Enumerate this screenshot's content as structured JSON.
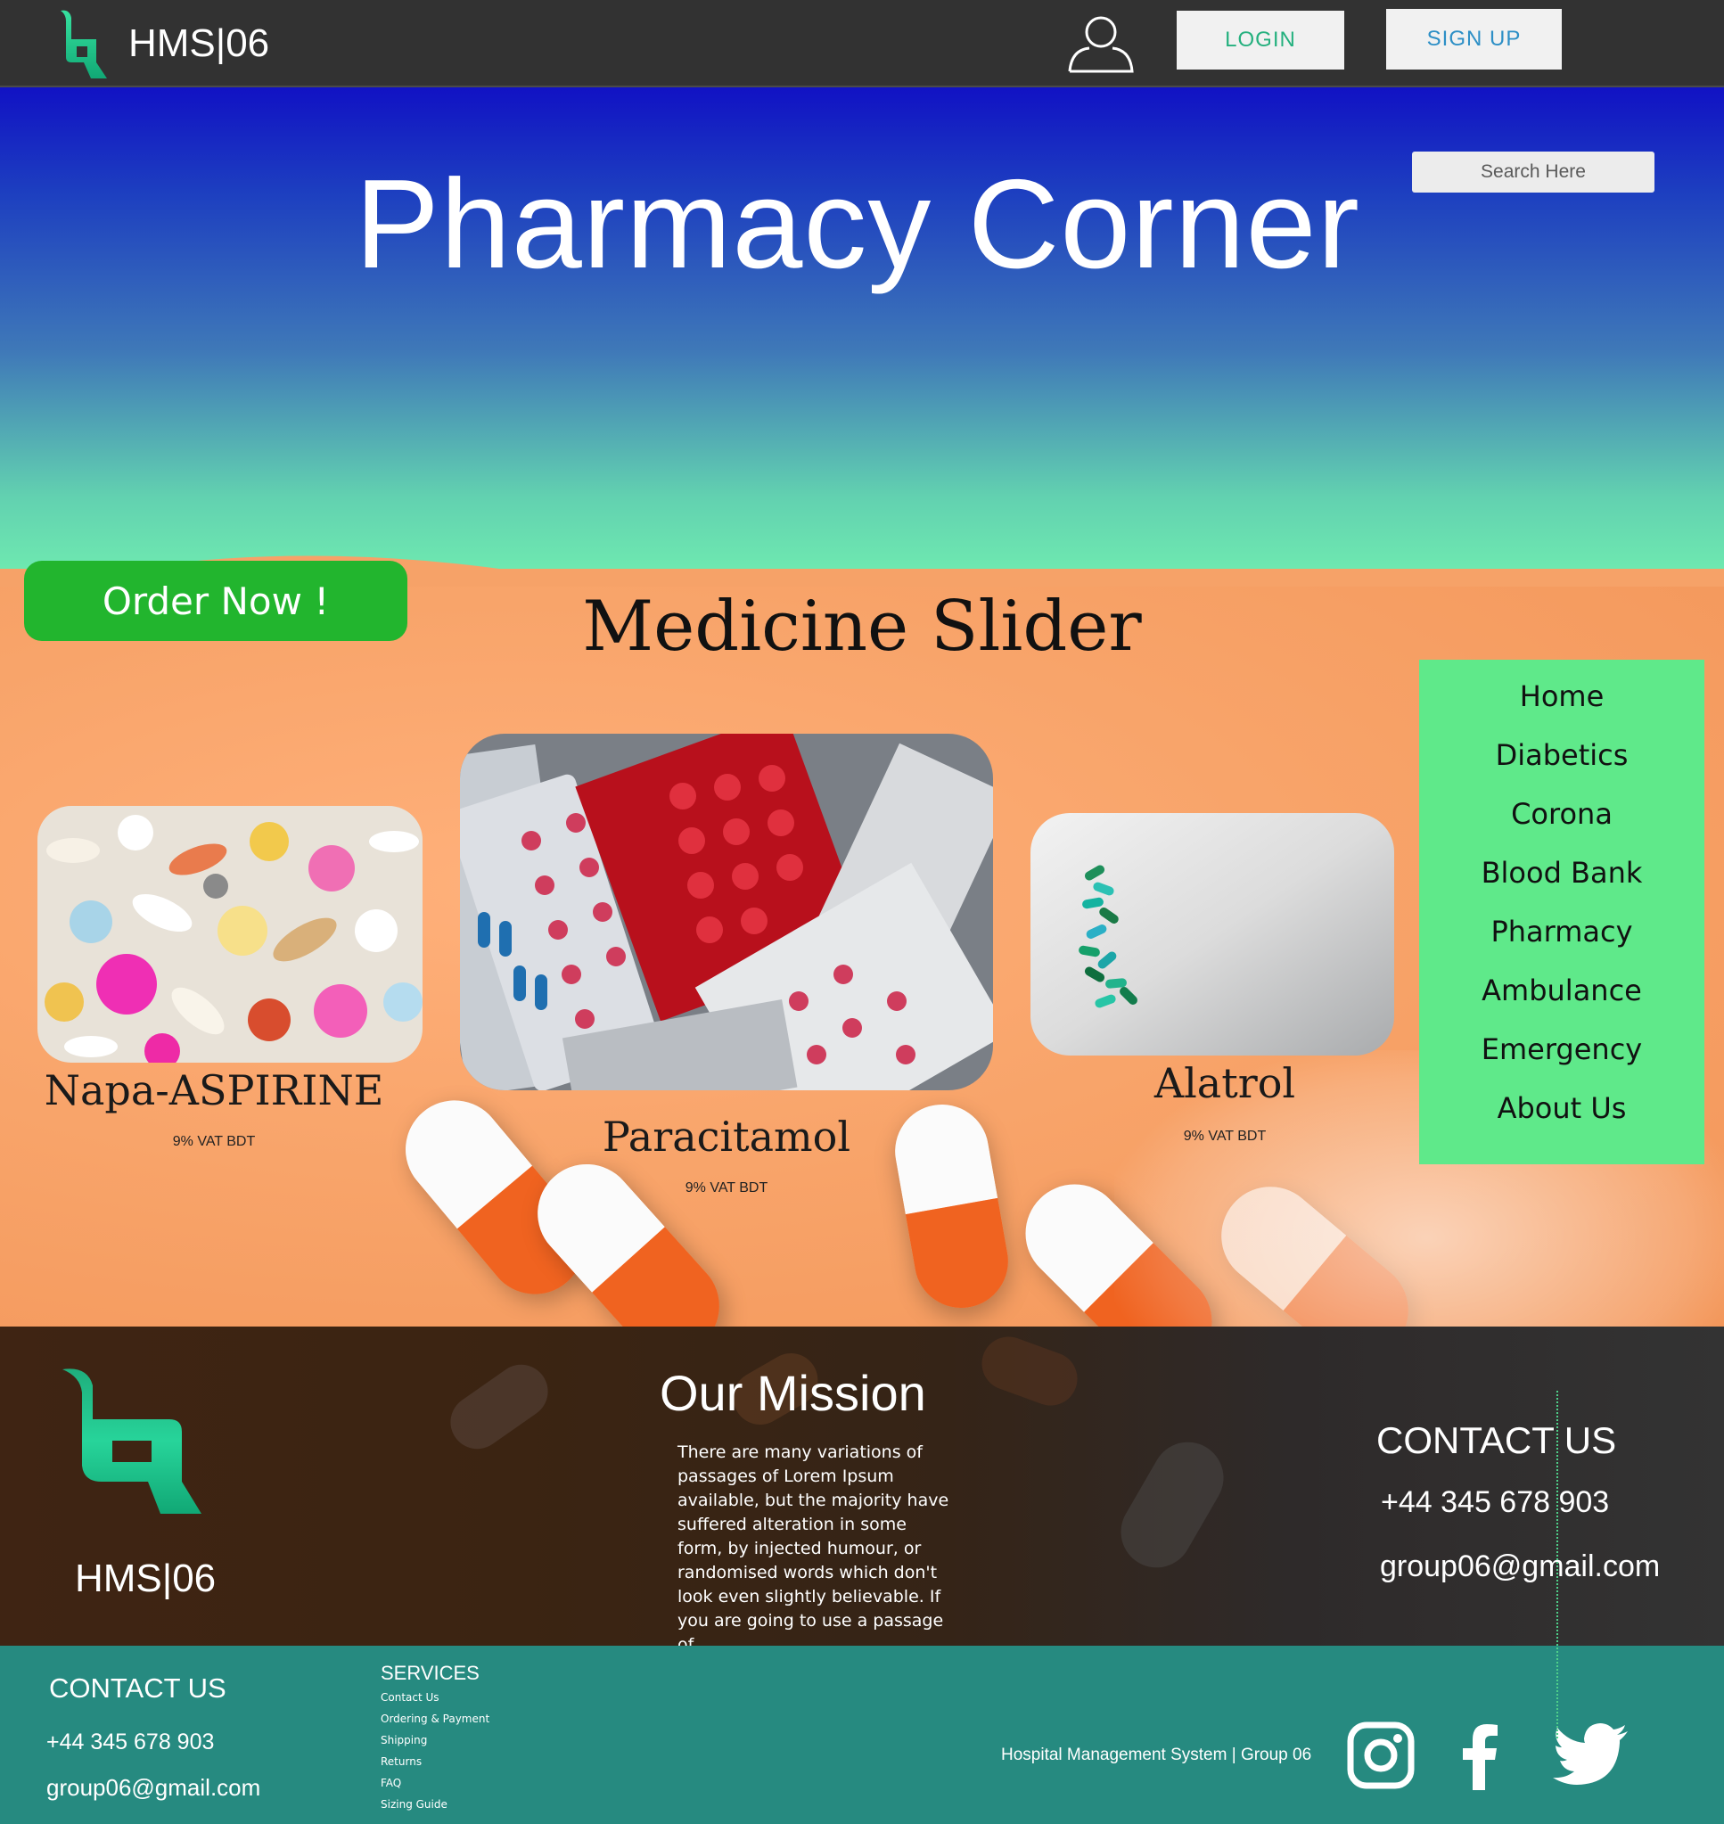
{
  "header": {
    "brand": "HMS|06",
    "login_label": "LOGIN",
    "signup_label": "SIGN UP"
  },
  "hero": {
    "title": "Pharmacy Corner",
    "search_placeholder": "Search Here",
    "order_button": "Order Now !",
    "slider_title": "Medicine Slider"
  },
  "medicines": [
    {
      "name": "Napa-ASPIRINE",
      "vat": "9% VAT BDT"
    },
    {
      "name": "Paracitamol",
      "vat": "9% VAT BDT"
    },
    {
      "name": "Alatrol",
      "vat": "9% VAT BDT"
    }
  ],
  "side_nav": {
    "items": [
      {
        "label": "Home"
      },
      {
        "label": "Diabetics"
      },
      {
        "label": "Corona"
      },
      {
        "label": "Blood Bank"
      },
      {
        "label": "Pharmacy"
      },
      {
        "label": "Ambulance"
      },
      {
        "label": "Emergency"
      },
      {
        "label": "About  Us"
      }
    ]
  },
  "mission": {
    "brand": "HMS|06",
    "title": "Our Mission",
    "text": "There are many variations of passages of Lorem Ipsum available, but the majority have suffered alteration in some form, by injected humour, or randomised words which don't look even slightly believable. If you are going to use a passage of",
    "contact_title": "CONTACT US",
    "phone": "+44 345 678 903",
    "email": "group06@gmail.com"
  },
  "footer": {
    "contact_title": "CONTACT US",
    "phone": "+44 345 678 903",
    "email": "group06@gmail.com",
    "services_title": "SERVICES",
    "services": [
      {
        "label": "Contact Us"
      },
      {
        "label": "Ordering & Payment"
      },
      {
        "label": "Shipping"
      },
      {
        "label": "Returns"
      },
      {
        "label": "FAQ"
      },
      {
        "label": "Sizing Guide"
      }
    ],
    "credit": "Hospital Management System | Group  06"
  },
  "icons": {
    "logo": "hms-logo-icon",
    "user": "user-icon",
    "instagram": "instagram-icon",
    "facebook": "facebook-icon",
    "twitter": "twitter-icon"
  },
  "colors": {
    "topbar": "#323232",
    "accent_green": "#22b52e",
    "nav_green": "#5fe98a",
    "footer_teal": "#268a80",
    "login_text": "#24b07e",
    "signup_text": "#2d8fc6"
  }
}
